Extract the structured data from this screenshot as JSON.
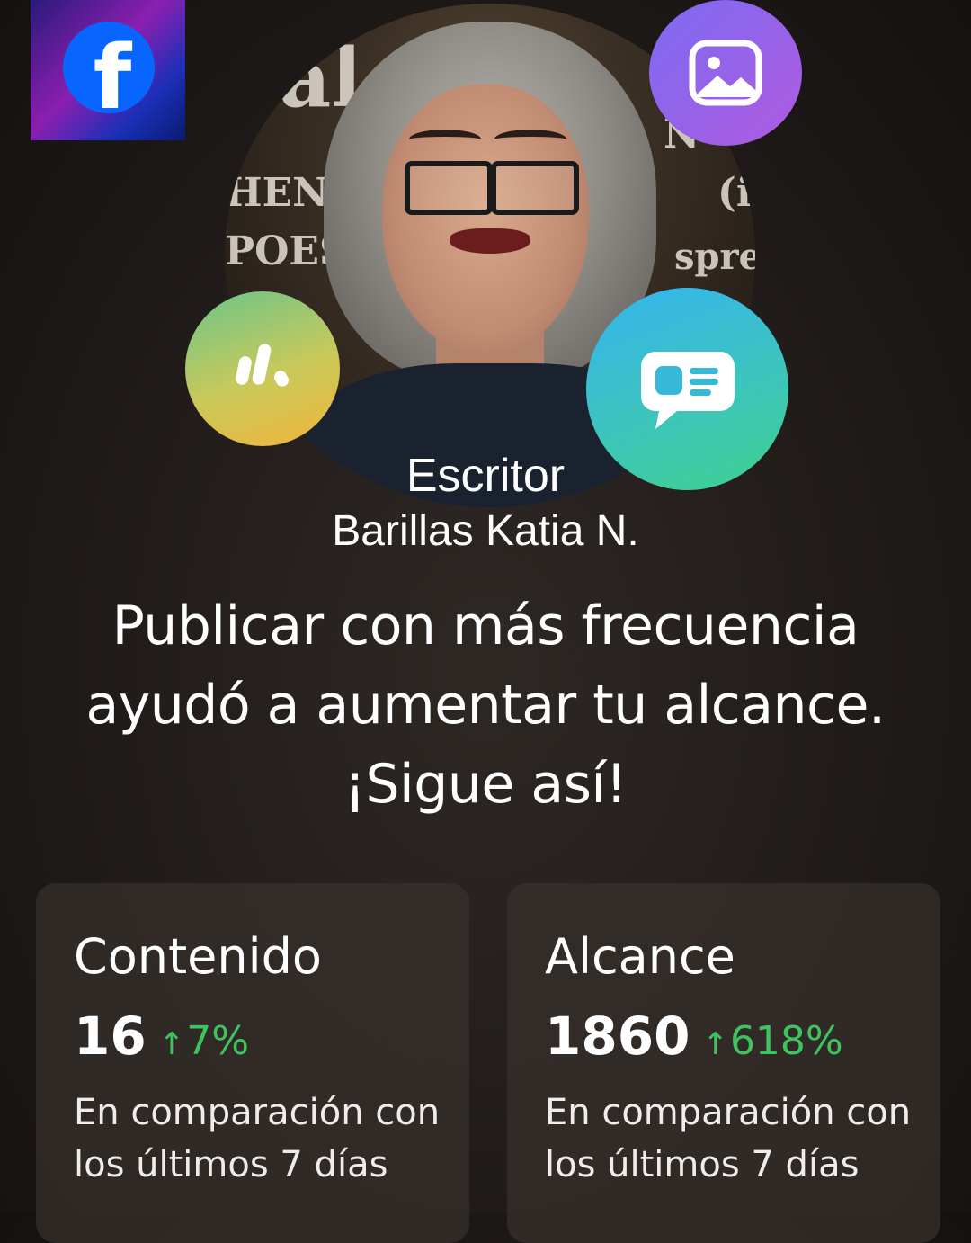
{
  "header": {
    "platform_icon": "facebook-icon",
    "platform_glyph": "f",
    "floating_icons": [
      "photo-icon",
      "stats-icon",
      "message-icon"
    ],
    "poster_text": [
      "al",
      "HEN",
      "POES",
      "N",
      "(i",
      "sprea"
    ]
  },
  "profile": {
    "role": "Escritor",
    "name": "Barillas Katia N."
  },
  "headline": {
    "line1": "Publicar con más frecuencia",
    "line2": "ayudó a aumentar tu alcance.",
    "line3": "¡Sigue así!"
  },
  "metrics": [
    {
      "title": "Contenido",
      "value": "16",
      "change_arrow": "↑",
      "change": "7%",
      "description": "En comparación con los últimos 7 días"
    },
    {
      "title": "Alcance",
      "value": "1860",
      "change_arrow": "↑",
      "change": "618%",
      "description": "En comparación con los últimos 7 días"
    }
  ],
  "colors": {
    "facebook_blue": "#0866ff",
    "positive_change": "#3ec45e",
    "card_background": "#37302c"
  }
}
